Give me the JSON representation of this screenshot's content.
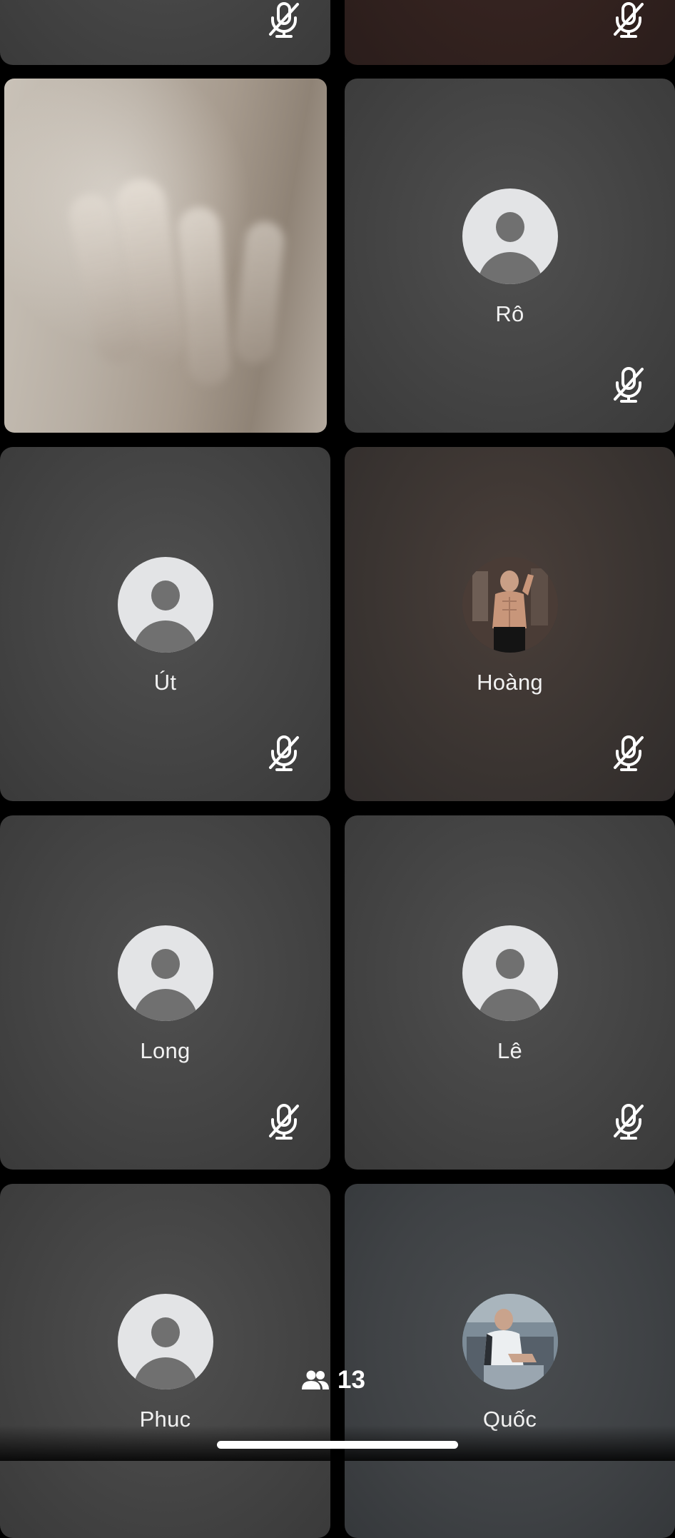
{
  "participants": [
    {
      "name": "",
      "avatar": "partial-tile",
      "muted": true
    },
    {
      "name": "",
      "avatar": "partial-tile",
      "muted": true
    },
    {
      "name": "",
      "avatar": "video-feed",
      "muted": false
    },
    {
      "name": "Rô",
      "avatar": "default-user-icon",
      "muted": true
    },
    {
      "name": "Út",
      "avatar": "default-user-icon",
      "muted": true
    },
    {
      "name": "Hoàng",
      "avatar": "profile-photo",
      "muted": true
    },
    {
      "name": "Long",
      "avatar": "default-user-icon",
      "muted": true
    },
    {
      "name": "Lê",
      "avatar": "default-user-icon",
      "muted": true
    },
    {
      "name": "Phuc",
      "avatar": "default-user-icon",
      "muted": false
    },
    {
      "name": "Quốc",
      "avatar": "profile-photo",
      "muted": false
    }
  ],
  "participant_count": "13",
  "icons": {
    "muted": "mic-off-icon",
    "people": "people-icon"
  },
  "colors": {
    "background": "#000000",
    "tile": "#474747",
    "text": "#f2f2f2",
    "avatar_bg": "#e3e4e6",
    "avatar_fg": "#707070"
  }
}
